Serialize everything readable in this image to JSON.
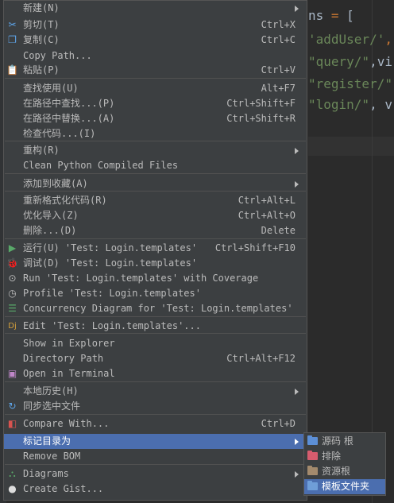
{
  "editor": {
    "code_lines": [
      {
        "parts": [
          {
            "t": "ns ",
            "c": "default"
          },
          {
            "t": "=",
            "c": "op"
          },
          {
            "t": " [",
            "c": "default"
          }
        ]
      },
      {
        "parts": [
          {
            "t": "'addUser/'",
            "c": "str"
          },
          {
            "t": ",",
            "c": "op"
          }
        ]
      },
      {
        "parts": [
          {
            "t": "\"query/\"",
            "c": "str"
          },
          {
            "t": ",vi",
            "c": "default"
          }
        ]
      },
      {
        "parts": [
          {
            "t": "\"register/\"",
            "c": "str"
          }
        ]
      },
      {
        "parts": [
          {
            "t": "\"login/\"",
            "c": "str"
          },
          {
            "t": ", v",
            "c": "default"
          }
        ]
      }
    ]
  },
  "menu": {
    "items": [
      {
        "label": "新建(N)",
        "submenu": true
      },
      {
        "label": "剪切(T)",
        "shortcut": "Ctrl+X",
        "icon": "scissors-icon",
        "glyph": "✂"
      },
      {
        "label": "复制(C)",
        "shortcut": "Ctrl+C",
        "icon": "copy-icon",
        "glyph": "❐"
      },
      {
        "label": "Copy Path..."
      },
      {
        "label": "粘贴(P)",
        "shortcut": "Ctrl+V",
        "icon": "paste-icon",
        "glyph": "📋"
      },
      {
        "sep": true
      },
      {
        "label": "查找使用(U)",
        "shortcut": "Alt+F7"
      },
      {
        "label": "在路径中查找...(P)",
        "shortcut": "Ctrl+Shift+F"
      },
      {
        "label": "在路径中替换...(A)",
        "shortcut": "Ctrl+Shift+R"
      },
      {
        "label": "检查代码...(I)"
      },
      {
        "sep": true
      },
      {
        "label": "重构(R)",
        "submenu": true
      },
      {
        "label": "Clean Python Compiled Files"
      },
      {
        "sep": true
      },
      {
        "label": "添加到收藏(A)",
        "submenu": true
      },
      {
        "sep": true
      },
      {
        "label": "重新格式化代码(R)",
        "shortcut": "Ctrl+Alt+L"
      },
      {
        "label": "优化导入(Z)",
        "shortcut": "Ctrl+Alt+O"
      },
      {
        "label": "删除...(D)",
        "shortcut": "Delete"
      },
      {
        "sep": true
      },
      {
        "label": "运行(U) 'Test: Login.templates'",
        "shortcut": "Ctrl+Shift+F10",
        "icon": "run-icon",
        "glyph": "▶"
      },
      {
        "label": "调试(D) 'Test: Login.templates'",
        "icon": "debug-icon",
        "glyph": "🐞"
      },
      {
        "label": "Run 'Test: Login.templates' with Coverage",
        "icon": "coverage-icon",
        "glyph": "⊙"
      },
      {
        "label": "Profile 'Test: Login.templates'",
        "icon": "profile-icon",
        "glyph": "◷"
      },
      {
        "label": "Concurrency Diagram for 'Test: Login.templates'",
        "icon": "concurrency-icon",
        "glyph": "☰"
      },
      {
        "sep": true
      },
      {
        "label": "Edit 'Test: Login.templates'...",
        "icon": "edit-config-icon",
        "glyph": "Dj"
      },
      {
        "sep": true
      },
      {
        "label": "Show in Explorer"
      },
      {
        "label": "Directory Path",
        "shortcut": "Ctrl+Alt+F12"
      },
      {
        "label": "Open in Terminal",
        "icon": "terminal-icon",
        "glyph": "▣"
      },
      {
        "sep": true
      },
      {
        "label": "本地历史(H)",
        "submenu": true
      },
      {
        "label": "同步选中文件",
        "icon": "sync-icon",
        "glyph": "↻"
      },
      {
        "sep": true
      },
      {
        "label": "Compare With...",
        "shortcut": "Ctrl+D",
        "icon": "compare-icon",
        "glyph": "◧"
      },
      {
        "label": "标记目录为",
        "submenu": true,
        "selected": true
      },
      {
        "label": "Remove BOM"
      },
      {
        "sep": true
      },
      {
        "label": "Diagrams",
        "submenu": true,
        "icon": "diagrams-icon",
        "glyph": "⛬"
      },
      {
        "label": "Create Gist...",
        "icon": "github-icon",
        "glyph": "●"
      }
    ]
  },
  "submenu": {
    "items": [
      {
        "label": "源码 根",
        "color": "#5c8fd6"
      },
      {
        "label": "排除",
        "color": "#d65c6e"
      },
      {
        "label": "资源根",
        "color": "#a38a6d"
      },
      {
        "label": "模板文件夹",
        "color": "#6f9ed8",
        "selected": true
      }
    ]
  }
}
